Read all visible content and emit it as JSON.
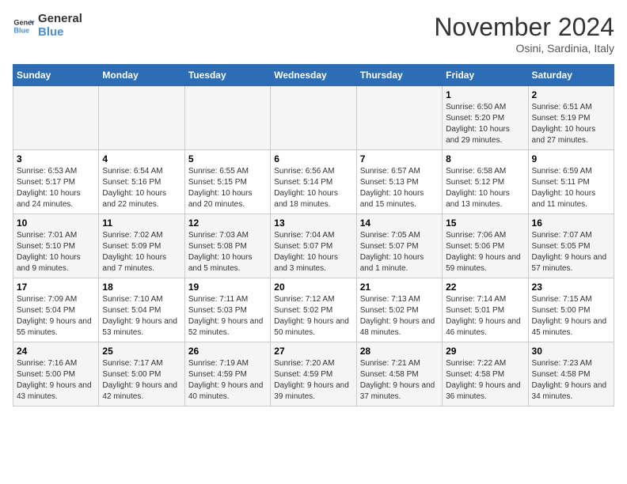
{
  "logo": {
    "line1": "General",
    "line2": "Blue"
  },
  "title": "November 2024",
  "location": "Osini, Sardinia, Italy",
  "weekdays": [
    "Sunday",
    "Monday",
    "Tuesday",
    "Wednesday",
    "Thursday",
    "Friday",
    "Saturday"
  ],
  "weeks": [
    [
      {
        "day": "",
        "info": ""
      },
      {
        "day": "",
        "info": ""
      },
      {
        "day": "",
        "info": ""
      },
      {
        "day": "",
        "info": ""
      },
      {
        "day": "",
        "info": ""
      },
      {
        "day": "1",
        "info": "Sunrise: 6:50 AM\nSunset: 5:20 PM\nDaylight: 10 hours and 29 minutes."
      },
      {
        "day": "2",
        "info": "Sunrise: 6:51 AM\nSunset: 5:19 PM\nDaylight: 10 hours and 27 minutes."
      }
    ],
    [
      {
        "day": "3",
        "info": "Sunrise: 6:53 AM\nSunset: 5:17 PM\nDaylight: 10 hours and 24 minutes."
      },
      {
        "day": "4",
        "info": "Sunrise: 6:54 AM\nSunset: 5:16 PM\nDaylight: 10 hours and 22 minutes."
      },
      {
        "day": "5",
        "info": "Sunrise: 6:55 AM\nSunset: 5:15 PM\nDaylight: 10 hours and 20 minutes."
      },
      {
        "day": "6",
        "info": "Sunrise: 6:56 AM\nSunset: 5:14 PM\nDaylight: 10 hours and 18 minutes."
      },
      {
        "day": "7",
        "info": "Sunrise: 6:57 AM\nSunset: 5:13 PM\nDaylight: 10 hours and 15 minutes."
      },
      {
        "day": "8",
        "info": "Sunrise: 6:58 AM\nSunset: 5:12 PM\nDaylight: 10 hours and 13 minutes."
      },
      {
        "day": "9",
        "info": "Sunrise: 6:59 AM\nSunset: 5:11 PM\nDaylight: 10 hours and 11 minutes."
      }
    ],
    [
      {
        "day": "10",
        "info": "Sunrise: 7:01 AM\nSunset: 5:10 PM\nDaylight: 10 hours and 9 minutes."
      },
      {
        "day": "11",
        "info": "Sunrise: 7:02 AM\nSunset: 5:09 PM\nDaylight: 10 hours and 7 minutes."
      },
      {
        "day": "12",
        "info": "Sunrise: 7:03 AM\nSunset: 5:08 PM\nDaylight: 10 hours and 5 minutes."
      },
      {
        "day": "13",
        "info": "Sunrise: 7:04 AM\nSunset: 5:07 PM\nDaylight: 10 hours and 3 minutes."
      },
      {
        "day": "14",
        "info": "Sunrise: 7:05 AM\nSunset: 5:07 PM\nDaylight: 10 hours and 1 minute."
      },
      {
        "day": "15",
        "info": "Sunrise: 7:06 AM\nSunset: 5:06 PM\nDaylight: 9 hours and 59 minutes."
      },
      {
        "day": "16",
        "info": "Sunrise: 7:07 AM\nSunset: 5:05 PM\nDaylight: 9 hours and 57 minutes."
      }
    ],
    [
      {
        "day": "17",
        "info": "Sunrise: 7:09 AM\nSunset: 5:04 PM\nDaylight: 9 hours and 55 minutes."
      },
      {
        "day": "18",
        "info": "Sunrise: 7:10 AM\nSunset: 5:04 PM\nDaylight: 9 hours and 53 minutes."
      },
      {
        "day": "19",
        "info": "Sunrise: 7:11 AM\nSunset: 5:03 PM\nDaylight: 9 hours and 52 minutes."
      },
      {
        "day": "20",
        "info": "Sunrise: 7:12 AM\nSunset: 5:02 PM\nDaylight: 9 hours and 50 minutes."
      },
      {
        "day": "21",
        "info": "Sunrise: 7:13 AM\nSunset: 5:02 PM\nDaylight: 9 hours and 48 minutes."
      },
      {
        "day": "22",
        "info": "Sunrise: 7:14 AM\nSunset: 5:01 PM\nDaylight: 9 hours and 46 minutes."
      },
      {
        "day": "23",
        "info": "Sunrise: 7:15 AM\nSunset: 5:00 PM\nDaylight: 9 hours and 45 minutes."
      }
    ],
    [
      {
        "day": "24",
        "info": "Sunrise: 7:16 AM\nSunset: 5:00 PM\nDaylight: 9 hours and 43 minutes."
      },
      {
        "day": "25",
        "info": "Sunrise: 7:17 AM\nSunset: 5:00 PM\nDaylight: 9 hours and 42 minutes."
      },
      {
        "day": "26",
        "info": "Sunrise: 7:19 AM\nSunset: 4:59 PM\nDaylight: 9 hours and 40 minutes."
      },
      {
        "day": "27",
        "info": "Sunrise: 7:20 AM\nSunset: 4:59 PM\nDaylight: 9 hours and 39 minutes."
      },
      {
        "day": "28",
        "info": "Sunrise: 7:21 AM\nSunset: 4:58 PM\nDaylight: 9 hours and 37 minutes."
      },
      {
        "day": "29",
        "info": "Sunrise: 7:22 AM\nSunset: 4:58 PM\nDaylight: 9 hours and 36 minutes."
      },
      {
        "day": "30",
        "info": "Sunrise: 7:23 AM\nSunset: 4:58 PM\nDaylight: 9 hours and 34 minutes."
      }
    ]
  ]
}
